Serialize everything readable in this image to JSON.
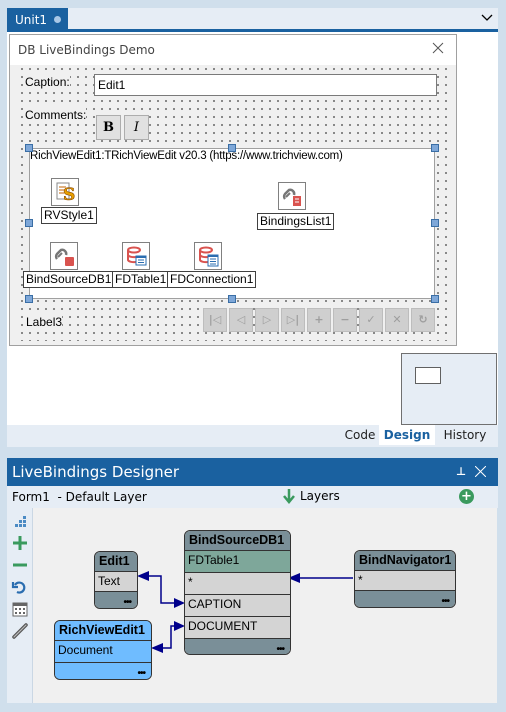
{
  "editor_tabs": [
    {
      "label": "Unit1",
      "modified": true,
      "active": true
    }
  ],
  "form": {
    "title": "DB LiveBindings Demo",
    "caption_label": "Caption:",
    "caption_value": "Edit1",
    "comments_label": "Comments:",
    "bold_label": "B",
    "italic_label": "I",
    "richview_text": "RichViewEdit1:TRichViewEdit v20.3 (https://www.trichview.com)",
    "components": [
      {
        "name": "RVStyle1",
        "icon": "rvstyle-icon"
      },
      {
        "name": "BindingsList1",
        "icon": "bindings-list-icon"
      },
      {
        "name": "BindSourceDB1",
        "icon": "bind-source-icon"
      },
      {
        "name": "FDTable1",
        "icon": "fdtable-icon"
      },
      {
        "name": "FDConnection1",
        "icon": "fdconnection-icon"
      }
    ],
    "label3": "Label3",
    "navigator_buttons": [
      {
        "name": "first",
        "glyph": "|◁"
      },
      {
        "name": "prior",
        "glyph": "◁"
      },
      {
        "name": "next",
        "glyph": "▷"
      },
      {
        "name": "last",
        "glyph": "▷|"
      },
      {
        "name": "insert",
        "glyph": "+"
      },
      {
        "name": "delete",
        "glyph": "−"
      },
      {
        "name": "post",
        "glyph": "✓"
      },
      {
        "name": "cancel",
        "glyph": "✕"
      },
      {
        "name": "refresh",
        "glyph": "↻"
      }
    ]
  },
  "view_tabs": [
    {
      "label": "Code",
      "active": false
    },
    {
      "label": "Design",
      "active": true
    },
    {
      "label": "History",
      "active": false
    }
  ],
  "livebindings": {
    "title": "LiveBindings Designer",
    "form_label": "Form1  - Default Layer",
    "layers_label": "Layers",
    "side_tools": [
      "arrange-icon",
      "zoom-in-icon",
      "zoom-out-icon",
      "undo-icon",
      "grid-icon",
      "link-icon"
    ],
    "nodes": {
      "edit1": {
        "title": "Edit1",
        "fields": [
          "Text"
        ]
      },
      "bindsource": {
        "title": "BindSourceDB1",
        "subtitle": "FDTable1",
        "fields": [
          "*",
          "CAPTION",
          "DOCUMENT"
        ]
      },
      "bindnavigator": {
        "title": "BindNavigator1",
        "fields": [
          "*"
        ]
      },
      "richviewedit": {
        "title": "RichViewEdit1",
        "fields": [
          "Document"
        ]
      }
    },
    "more_glyph": "•••"
  },
  "colors": {
    "accent": "#1a61a0",
    "chrome": "#d0dfec",
    "node_gray": "#7a8f98",
    "node_blue": "#6fbcff",
    "node_teal": "#7ea79a",
    "link": "#00008b"
  }
}
